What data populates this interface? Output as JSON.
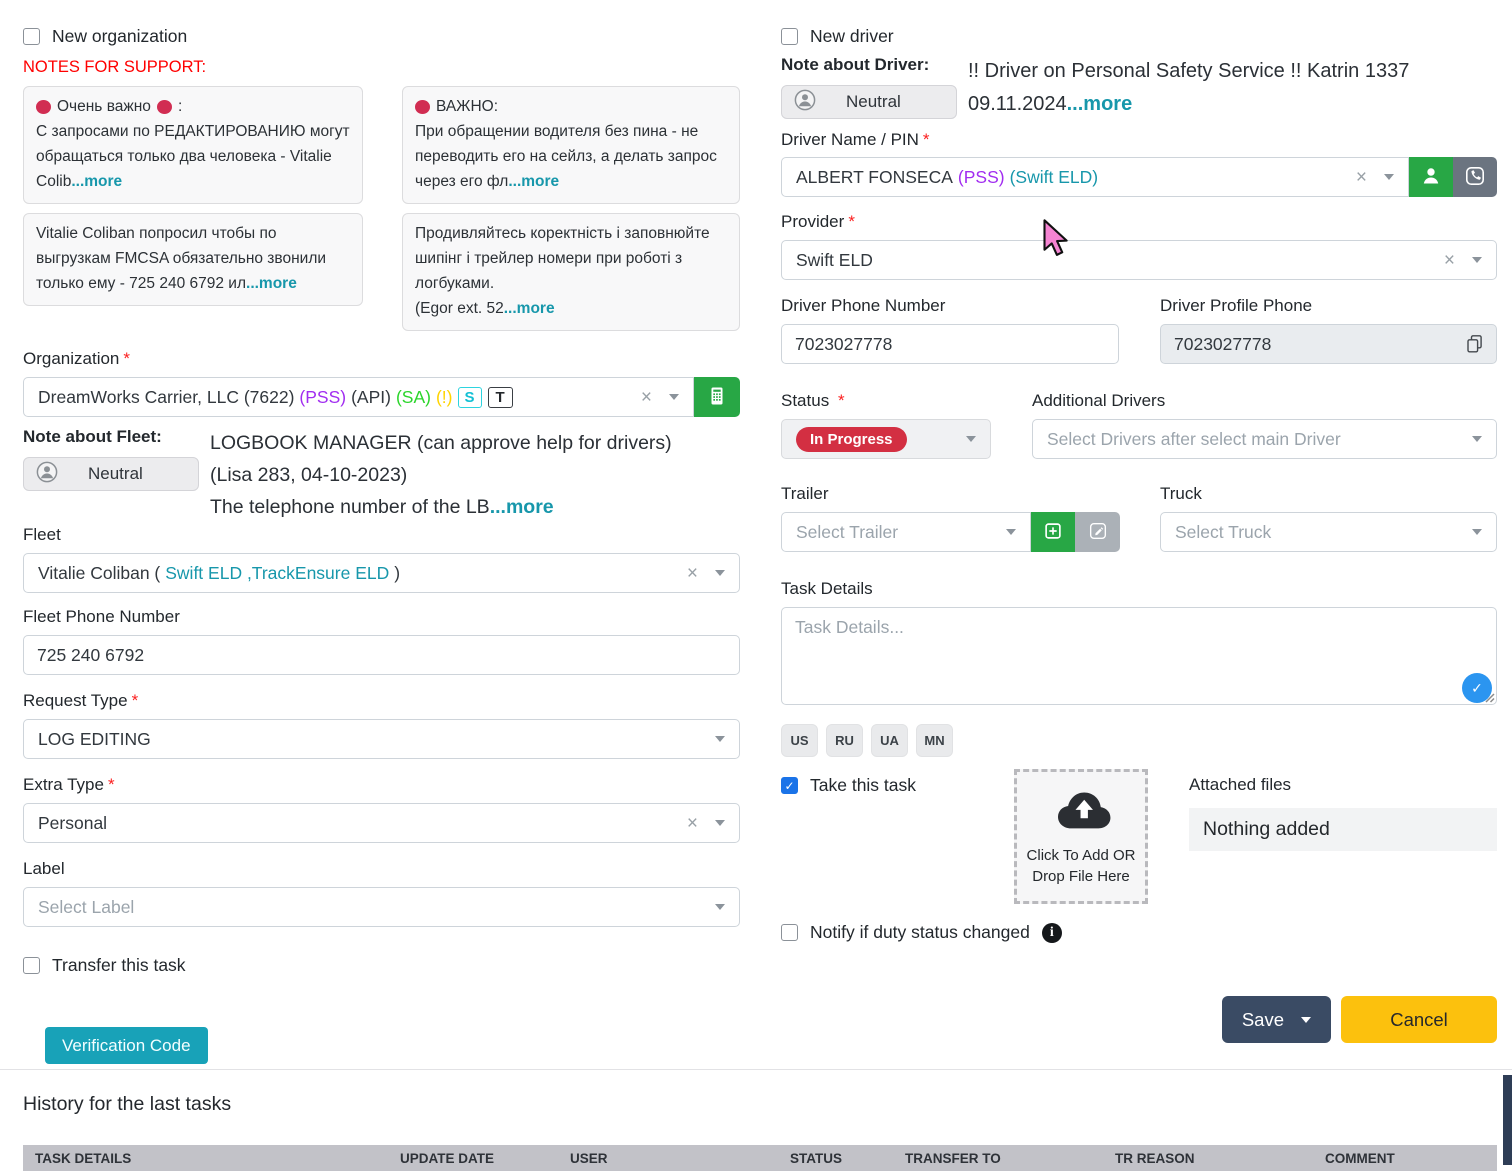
{
  "colors": {
    "accent_teal": "#1797ab",
    "button_green": "#28a745",
    "save_navy": "#3a4b64",
    "cancel_yellow": "#fcc10d",
    "verify_teal": "#18a2b8",
    "status_red": "#d32f42",
    "notes_red": "#ff0000",
    "pss_purple": "#a12df0",
    "sa_green": "#2bd52b",
    "warn_yellow": "#ffd400",
    "checkbox_blue": "#1a73e8"
  },
  "icons": {
    "clear-icon": "×",
    "chevron-down-icon": "▾",
    "check-icon": "✓",
    "info-icon": "i",
    "red-dot-icon": "●",
    "person-icon": "silhouette",
    "person-circle-icon": "silhouette-in-circle",
    "phone-icon": "handset",
    "copy-icon": "two-sheets",
    "calculator-icon": "keypad",
    "plus-square-icon": "⊞",
    "pencil-icon": "✎",
    "cloud-upload-icon": "cloud-arrow-up",
    "mouse-cursor": "pink-arrow"
  },
  "left": {
    "new_organization": "New organization",
    "notes_for_support": "NOTES FOR SUPPORT:",
    "notes": [
      {
        "title": "Очень важно",
        "colon": " :",
        "body": "С запросами по РЕДАКТИРОВАНИЮ могут обращаться только два человека - Vitalie Colib",
        "more": "...more"
      },
      {
        "title": "ВАЖНО:",
        "body": "При обращении водителя без пина - не переводить его на сейлз, а делать запрос через его фл",
        "more": "...more"
      },
      {
        "body": "Vitalie Coliban попросил чтобы по выгрузкам FMCSA  обязательно звонили только ему - 725 240 6792  ил",
        "more": "...more"
      },
      {
        "body": "Продивляйтесь коректність і заповнюйте шипінг і трейлер номери при роботі з логбуками.",
        "body2": "(Egor ext. 52",
        "more": "...more"
      }
    ],
    "organization_label": "Organization",
    "organization": {
      "name": "DreamWorks Carrier, LLC (7622)",
      "pss": "(PSS)",
      "api": "(API)",
      "sa": "(SA)",
      "warn": "(!)",
      "badge_s": "S",
      "badge_t": "T"
    },
    "note_about_fleet_label": "Note about Fleet:",
    "fleet_sentiment": "Neutral",
    "note_about_fleet": {
      "line1": "LOGBOOK MANAGER (can approve help for drivers)",
      "line2": "(Lisa 283, 04-10-2023)",
      "line3": "The telephone number of the LB",
      "more": "...more"
    },
    "fleet_label": "Fleet",
    "fleet_value": {
      "prefix": "Vitalie Coliban ( ",
      "link": "Swift ELD ,TrackEnsure ELD",
      "suffix": " )"
    },
    "fleet_phone_label": "Fleet Phone Number",
    "fleet_phone": "725 240 6792",
    "request_type_label": "Request Type",
    "request_type": "LOG EDITING",
    "extra_type_label": "Extra Type",
    "extra_type": "Personal",
    "label_label": "Label",
    "label_placeholder": "Select Label",
    "transfer_task": "Transfer this task",
    "verification_code": "Verification Code"
  },
  "right": {
    "new_driver": "New driver",
    "note_about_driver_label": "Note about Driver:",
    "driver_sentiment": "Neutral",
    "note_about_driver": {
      "line1": "!! Driver on Personal Safety Service !! Katrin 1337",
      "line2": "09.11.2024",
      "more": "...more"
    },
    "driver_name_label": "Driver Name / PIN",
    "driver_name": {
      "name": "ALBERT FONSECA",
      "pss": "(PSS)",
      "eld": "(Swift ELD)"
    },
    "provider_label": "Provider",
    "provider": "Swift ELD",
    "driver_phone_label": "Driver Phone Number",
    "driver_phone": "7023027778",
    "profile_phone_label": "Driver Profile Phone",
    "profile_phone": "7023027778",
    "status_label": "Status",
    "status": "In Progress",
    "additional_drivers_label": "Additional Drivers",
    "additional_drivers_placeholder": "Select Drivers after select main Driver",
    "trailer_label": "Trailer",
    "trailer_placeholder": "Select Trailer",
    "truck_label": "Truck",
    "truck_placeholder": "Select Truck",
    "task_details_label": "Task Details",
    "task_details_placeholder": "Task Details...",
    "languages": [
      "US",
      "RU",
      "UA",
      "MN"
    ],
    "take_this_task": "Take this task",
    "upload_text1": "Click To Add OR",
    "upload_text2": "Drop File Here",
    "attached_files_label": "Attached files",
    "attached_files_value": "Nothing added",
    "notify_label": "Notify if duty status changed",
    "save": "Save",
    "cancel": "Cancel"
  },
  "history": {
    "title": "History for the last tasks",
    "columns": [
      "TASK DETAILS",
      "UPDATE DATE",
      "USER",
      "STATUS",
      "TRANSFER TO",
      "TR REASON",
      "COMMENT"
    ]
  }
}
